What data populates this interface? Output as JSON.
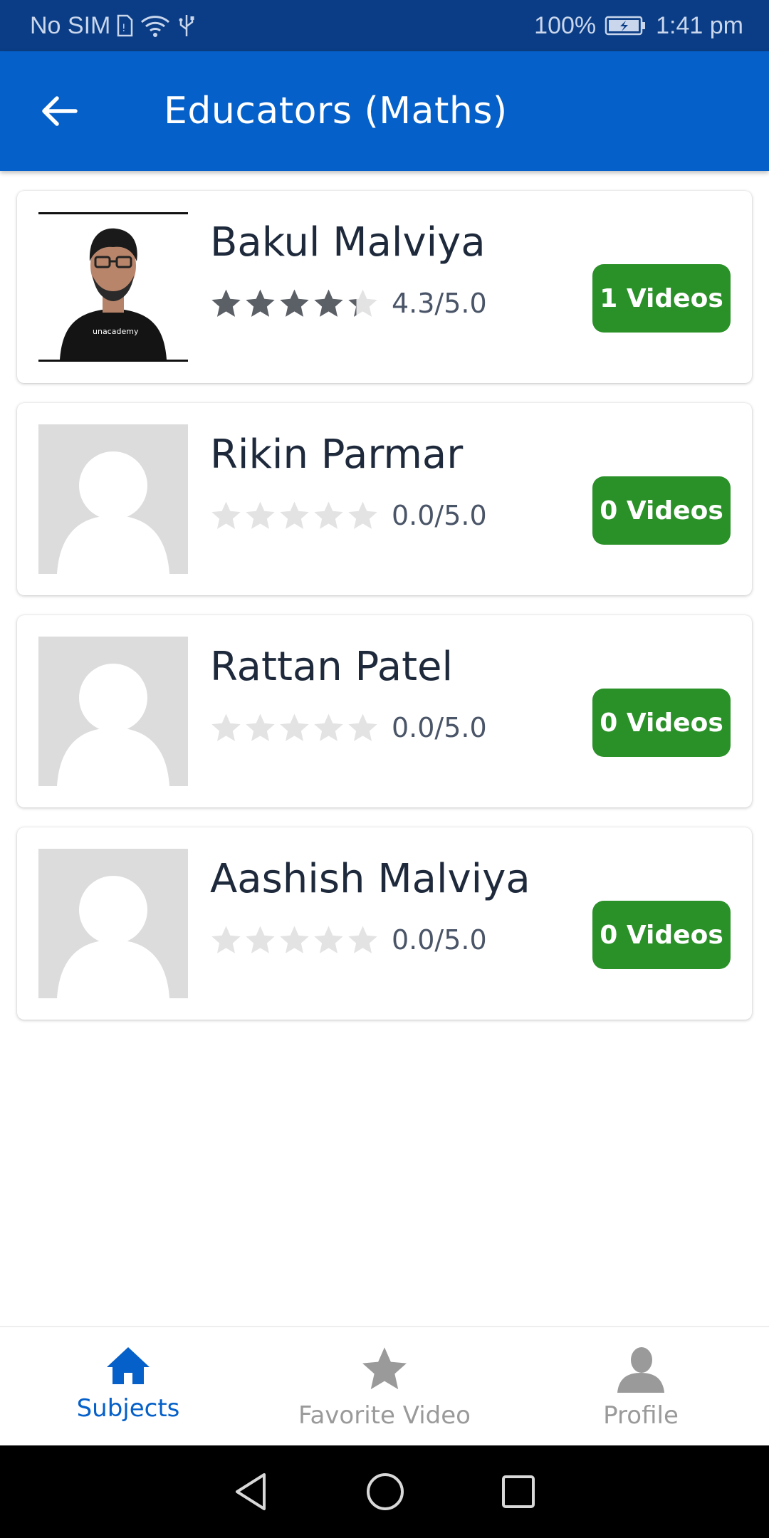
{
  "status_bar": {
    "carrier": "No SIM",
    "battery": "100%",
    "time": "1:41 pm",
    "icons": [
      "sim-card-icon",
      "wifi-icon",
      "usb-icon",
      "battery-charging-icon"
    ]
  },
  "app_bar": {
    "title": "Educators (Maths)",
    "back_icon": "arrow-left-icon"
  },
  "educators": [
    {
      "name": "Bakul Malviya",
      "rating": 4.3,
      "rating_text": "4.3/5.0",
      "videos_label": "1 Videos",
      "has_photo": true
    },
    {
      "name": "Rikin Parmar",
      "rating": 0.0,
      "rating_text": "0.0/5.0",
      "videos_label": "0 Videos",
      "has_photo": false
    },
    {
      "name": "Rattan Patel",
      "rating": 0.0,
      "rating_text": "0.0/5.0",
      "videos_label": "0 Videos",
      "has_photo": false
    },
    {
      "name": "Aashish Malviya",
      "rating": 0.0,
      "rating_text": "0.0/5.0",
      "videos_label": "0 Videos",
      "has_photo": false
    }
  ],
  "photo_logo_text": "unacademy",
  "bottom_nav": {
    "items": [
      {
        "label": "Subjects",
        "icon": "home-icon",
        "active": true
      },
      {
        "label": "Favorite Video",
        "icon": "star-icon",
        "active": false
      },
      {
        "label": "Profile",
        "icon": "person-icon",
        "active": false
      }
    ]
  },
  "colors": {
    "status_bar": "#0a3d85",
    "app_bar": "#0560c9",
    "accent": "#0560c9",
    "videos_button": "#2a9128",
    "star_filled": "#5b5f66",
    "star_empty": "#e3e3e3"
  }
}
